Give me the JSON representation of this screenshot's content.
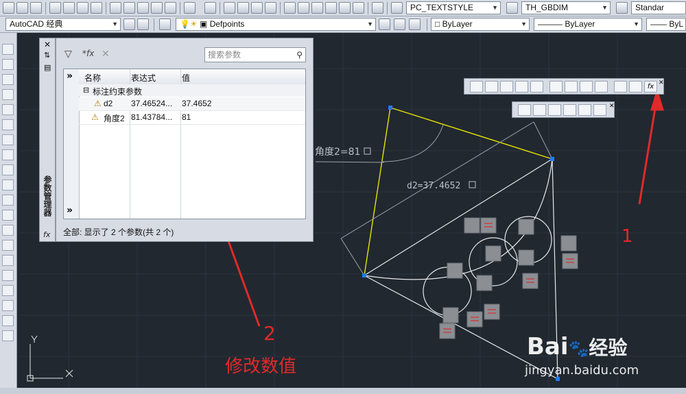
{
  "toolbar_top": {
    "textstyle_value": "PC_TEXTSTYLE",
    "dimstyle_value": "TH_GBDIM",
    "tablestyle_value": "Standar"
  },
  "toolbar_second": {
    "workspace_value": "AutoCAD 经典",
    "layer_value": "Defpoints",
    "color_value": "ByLayer",
    "linetype_value": "ByLayer",
    "lineweight_value": "ByL"
  },
  "param_manager": {
    "side_title": "参数管理器",
    "search_placeholder": "搜索参数",
    "columns": {
      "name": "名称",
      "expression": "表达式",
      "value": "值"
    },
    "group_label": "标注约束参数",
    "rows": [
      {
        "name": "d2",
        "expression": "37.46524...",
        "value": "37.4652"
      },
      {
        "name": "角度2",
        "expression": "81.43784...",
        "value": "81"
      }
    ],
    "status": "全部: 显示了 2 个参数(共 2 个)",
    "expand_glyph": "»",
    "fx_label": "fx"
  },
  "drawing": {
    "angle_label": "角度2=81",
    "dim_label": "d2=37.4652"
  },
  "annotations": {
    "label_1": "1",
    "label_2": "2",
    "caption": "修改数值"
  },
  "watermark": {
    "brand": "Bai",
    "brand2": "经验",
    "url": "jingyan.baidu.com"
  },
  "colors": {
    "canvas": "#212830",
    "toolbar": "#d6dbe4",
    "annotation_red": "#e02a2a",
    "constraint_yellow": "#e6e600",
    "grip_blue": "#1e7cff"
  }
}
